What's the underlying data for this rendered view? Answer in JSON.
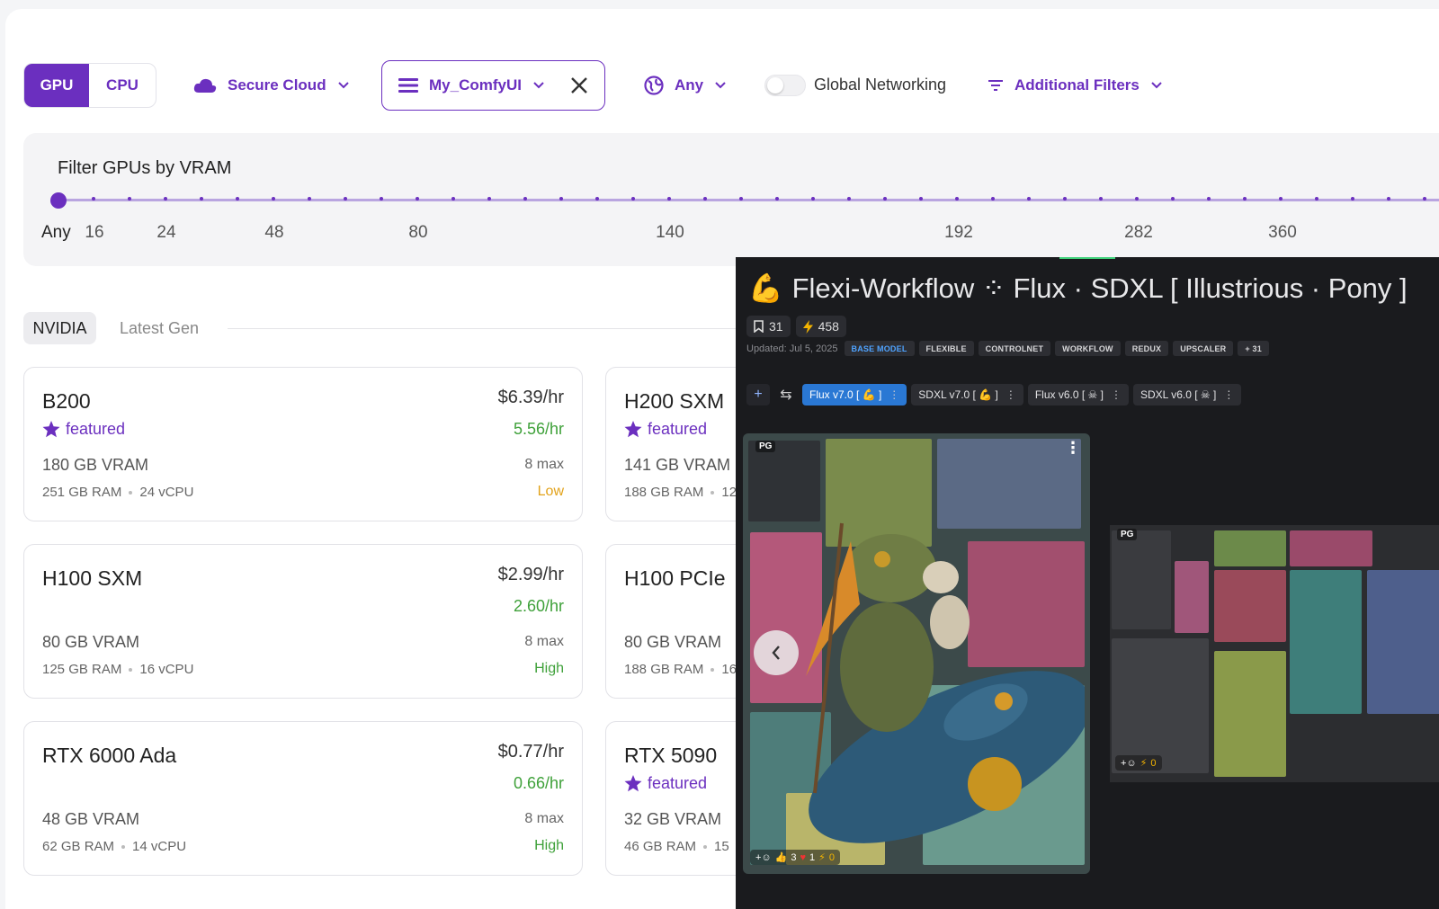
{
  "toolbar": {
    "gpu_label": "GPU",
    "cpu_label": "CPU",
    "cloud_label": "Secure Cloud",
    "template_label": "My_ComfyUI",
    "region_label": "Any",
    "networking_label": "Global Networking",
    "filters_label": "Additional Filters"
  },
  "vram": {
    "title": "Filter GPUs by VRAM",
    "ticks": [
      "Any",
      "16",
      "24",
      "48",
      "80",
      "140",
      "192",
      "282",
      "360"
    ]
  },
  "tabs": {
    "active": "NVIDIA",
    "inactive": "Latest Gen"
  },
  "cards": [
    {
      "name": "B200",
      "featured": "featured",
      "vram": "180 GB VRAM",
      "ram": "251 GB RAM",
      "vcpu": "24 vCPU",
      "price": "$6.39/hr",
      "spot": "5.56/hr",
      "max": "8 max",
      "avail": "Low",
      "avail_color": "#e2a21a"
    },
    {
      "name": "H200 SXM",
      "featured": "featured",
      "vram": "141 GB VRAM",
      "ram": "188 GB RAM",
      "vcpu": "12"
    },
    {
      "name": "H100 SXM",
      "vram": "80 GB VRAM",
      "ram": "125 GB RAM",
      "vcpu": "16 vCPU",
      "price": "$2.99/hr",
      "spot": "2.60/hr",
      "max": "8 max",
      "avail": "High",
      "avail_color": "#3fa13a"
    },
    {
      "name": "H100 PCIe",
      "vram": "80 GB VRAM",
      "ram": "188 GB RAM",
      "vcpu": "16"
    },
    {
      "name": "RTX 6000 Ada",
      "vram": "48 GB VRAM",
      "ram": "62 GB RAM",
      "vcpu": "14 vCPU",
      "price": "$0.77/hr",
      "spot": "0.66/hr",
      "max": "8 max",
      "avail": "High",
      "avail_color": "#3fa13a"
    },
    {
      "name": "RTX 5090",
      "featured": "featured",
      "vram": "32 GB VRAM",
      "ram": "46 GB RAM",
      "vcpu": "15"
    }
  ],
  "panel": {
    "title": "Flexi-Workflow ⁘ Flux · SDXL [ Illustrious · Pony ]",
    "bookmarks": "31",
    "bolts": "458",
    "updated": "Updated: Jul 5, 2025",
    "tags": [
      "BASE MODEL",
      "FLEXIBLE",
      "CONTROLNET",
      "WORKFLOW",
      "REDUX",
      "UPSCALER",
      "+ 31"
    ],
    "versions": [
      "Flux v7.0 [ 💪 ]",
      "SDXL v7.0 [ 💪 ]",
      "Flux v6.0 [ ☠ ]",
      "SDXL v6.0 [ ☠ ]"
    ],
    "main_badge": "PG",
    "side_badge": "PG",
    "main_likes": "3",
    "main_hearts": "1",
    "main_bolts": "0",
    "side_bolts": "0"
  }
}
